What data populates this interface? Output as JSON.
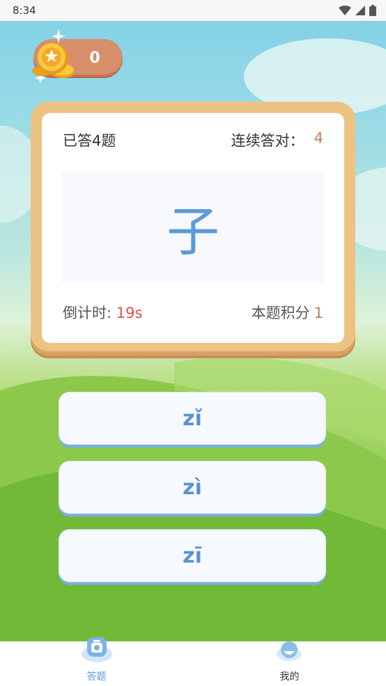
{
  "status_bar": {
    "time": "8:34"
  },
  "header": {
    "coins": "0"
  },
  "quiz": {
    "answered": "已答4题",
    "streak_label": "连续答对：",
    "streak_value": "4",
    "character": "子",
    "countdown_label": "倒计时: ",
    "countdown_value": "19s",
    "points_label": "本题积分",
    "points_value": "1"
  },
  "options": [
    "zǐ",
    "zì",
    "zī"
  ],
  "nav": [
    {
      "label": "答题",
      "icon": "quiz-icon",
      "active": true
    },
    {
      "label": "我的",
      "icon": "profile-icon",
      "active": false
    }
  ],
  "colors": {
    "accent": "#5b9ad7",
    "countdown": "#e24d4d",
    "streak": "#c57b55",
    "frame": "#ecc383"
  }
}
